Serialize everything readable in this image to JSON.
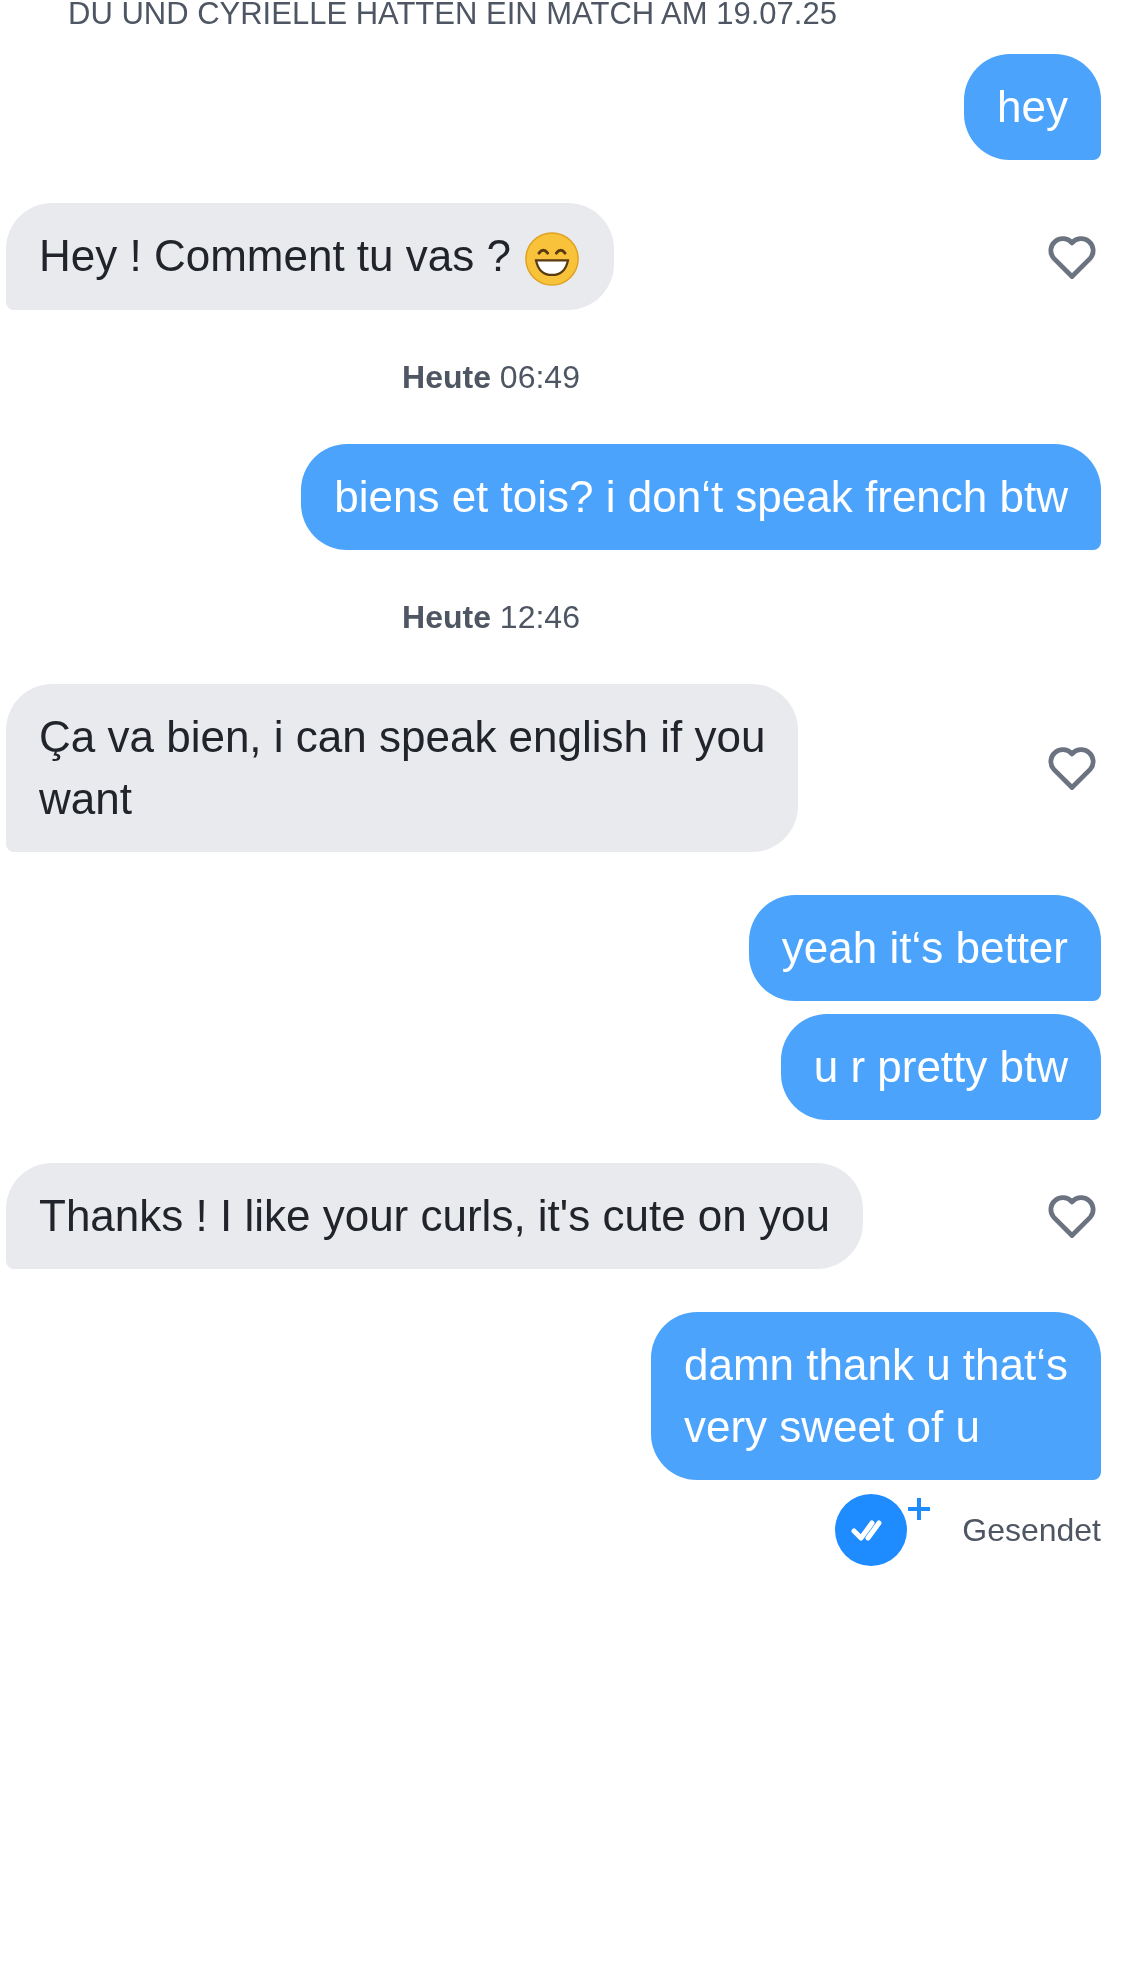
{
  "match_notice": "DU UND CYRIELLE HATTEN EIN MATCH AM 19.07.25",
  "messages": [
    {
      "kind": "sent",
      "lines": [
        "hey"
      ]
    },
    {
      "kind": "received",
      "lines": [
        "Hey ! Comment tu vas ?"
      ],
      "has_emoji": true,
      "liked": false
    },
    {
      "kind": "timestamp",
      "day": "Heute",
      "time": "06:49"
    },
    {
      "kind": "sent",
      "lines": [
        "biens et tois? i don‘t speak french btw"
      ]
    },
    {
      "kind": "timestamp",
      "day": "Heute",
      "time": "12:46"
    },
    {
      "kind": "received",
      "lines": [
        "Ça va bien, i can speak english if you",
        "want"
      ],
      "liked": false
    },
    {
      "kind": "sent",
      "lines": [
        "yeah it‘s better"
      ]
    },
    {
      "kind": "sent",
      "lines": [
        "u r pretty btw"
      ]
    },
    {
      "kind": "received",
      "lines": [
        "Thanks ! I like your curls, it's cute on you"
      ],
      "liked": false
    },
    {
      "kind": "sent",
      "lines": [
        "damn thank u that‘s",
        "very sweet of u"
      ]
    }
  ],
  "status": {
    "label": "Gesendet",
    "read": true
  }
}
